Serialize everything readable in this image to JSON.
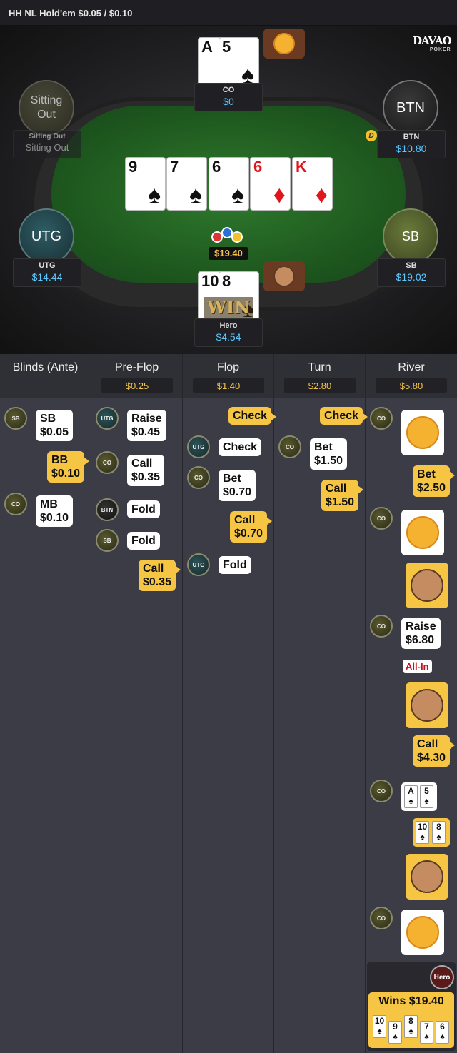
{
  "header": {
    "title": "HH NL Hold'em $0.05 / $0.10"
  },
  "logo": {
    "name": "DAVAO",
    "sub": "POKER"
  },
  "seats": {
    "co": {
      "name": "CO",
      "stack": "$0",
      "cards": [
        {
          "rank": "A",
          "suit": "♠"
        },
        {
          "rank": "5",
          "suit": "♠"
        }
      ]
    },
    "btn": {
      "circle": "BTN",
      "name": "BTN",
      "stack": "$10.80"
    },
    "sitting": {
      "circle_line1": "Sitting",
      "circle_line2": "Out",
      "name": "Sitting Out",
      "stack": "Sitting Out"
    },
    "utg": {
      "circle": "UTG",
      "name": "UTG",
      "stack": "$14.44"
    },
    "sb": {
      "circle": "SB",
      "name": "SB",
      "stack": "$19.02"
    },
    "hero": {
      "name": "Hero",
      "stack": "$4.54",
      "cards": [
        {
          "rank": "10",
          "suit": "♠"
        },
        {
          "rank": "8",
          "suit": "♠"
        }
      ],
      "badge": "WIN"
    }
  },
  "dealer_button": "D",
  "board": [
    {
      "rank": "9",
      "suit": "♠"
    },
    {
      "rank": "7",
      "suit": "♠"
    },
    {
      "rank": "6",
      "suit": "♠"
    },
    {
      "rank": "6",
      "suit": "♦"
    },
    {
      "rank": "K",
      "suit": "♦"
    }
  ],
  "pot": "$19.40",
  "history": {
    "columns": [
      {
        "title": "Blinds (Ante)",
        "pot": ""
      },
      {
        "title": "Pre-Flop",
        "pot": "$0.25"
      },
      {
        "title": "Flop",
        "pot": "$1.40"
      },
      {
        "title": "Turn",
        "pot": "$2.80"
      },
      {
        "title": "River",
        "pot": "$5.80"
      }
    ],
    "blinds": [
      {
        "pos": "SB",
        "action": "SB",
        "amount": "$0.05"
      },
      {
        "pos": "",
        "action": "BB",
        "amount": "$0.10"
      },
      {
        "pos": "CO",
        "action": "MB",
        "amount": "$0.10"
      }
    ],
    "preflop": [
      {
        "pos": "UTG",
        "action": "Raise",
        "amount": "$0.45"
      },
      {
        "pos": "CO",
        "action": "Call",
        "amount": "$0.35"
      },
      {
        "pos": "BTN",
        "action": "Fold",
        "amount": ""
      },
      {
        "pos": "SB",
        "action": "Fold",
        "amount": ""
      },
      {
        "pos": "",
        "action": "Call",
        "amount": "$0.35"
      }
    ],
    "flop": [
      {
        "pos": "",
        "action": "Check",
        "amount": ""
      },
      {
        "pos": "UTG",
        "action": "Check",
        "amount": ""
      },
      {
        "pos": "CO",
        "action": "Bet",
        "amount": "$0.70"
      },
      {
        "pos": "",
        "action": "Call",
        "amount": "$0.70"
      },
      {
        "pos": "UTG",
        "action": "Fold",
        "amount": ""
      }
    ],
    "turn": [
      {
        "pos": "",
        "action": "Check",
        "amount": ""
      },
      {
        "pos": "CO",
        "action": "Bet",
        "amount": "$1.50"
      },
      {
        "pos": "",
        "action": "Call",
        "amount": "$1.50"
      }
    ],
    "river": {
      "co": "CO",
      "bet": {
        "action": "Bet",
        "amount": "$2.50"
      },
      "raise": {
        "action": "Raise",
        "amount": "$6.80"
      },
      "allin": "All-In",
      "call": {
        "action": "Call",
        "amount": "$4.30"
      },
      "co_show": [
        "A",
        "5"
      ],
      "hero_show": [
        "10",
        "8"
      ],
      "hero_badge": "Hero",
      "wins": "Wins $19.40",
      "winning_hand": [
        "10",
        "9",
        "8",
        "7",
        "6"
      ]
    }
  }
}
